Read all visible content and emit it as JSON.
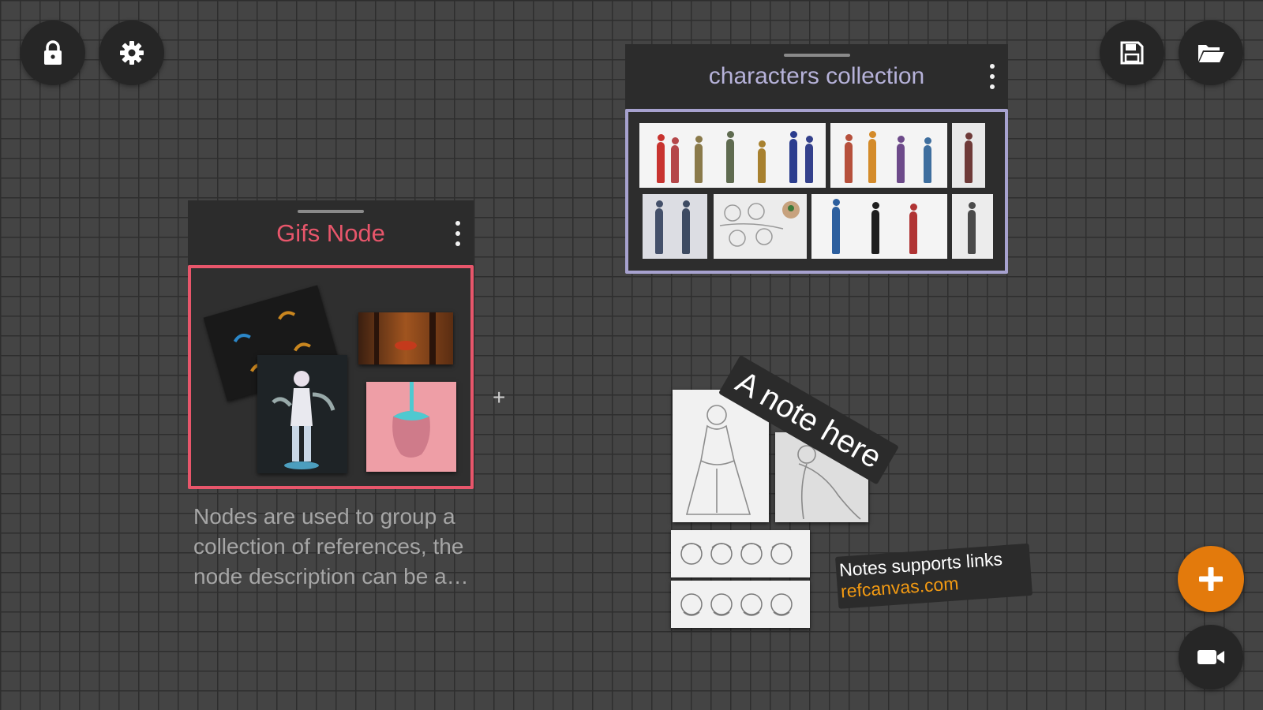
{
  "toolbar": {
    "left": [
      {
        "name": "lock-icon",
        "label": ""
      },
      {
        "name": "gear-icon",
        "label": ""
      }
    ],
    "right": [
      {
        "name": "save-icon",
        "label": ""
      },
      {
        "name": "folder-open-icon",
        "label": ""
      }
    ]
  },
  "gifs_node": {
    "title": "Gifs Node",
    "color": "#e8566b",
    "description": "Nodes are used to group a collection of references, the node description can be a…"
  },
  "characters_node": {
    "title": "characters collection",
    "color": "#a7a2cf"
  },
  "notes": {
    "big_note": "A note here",
    "links_note_text": "Notes supports links",
    "links_note_link": "refcanvas.com",
    "link_color": "#f39a12"
  },
  "canvas": {
    "background": "#444444",
    "edge_handle": "+"
  },
  "fab": {
    "add_icon": "plus-icon",
    "add_color": "#e37a0c",
    "record_icon": "video-camera-icon"
  }
}
